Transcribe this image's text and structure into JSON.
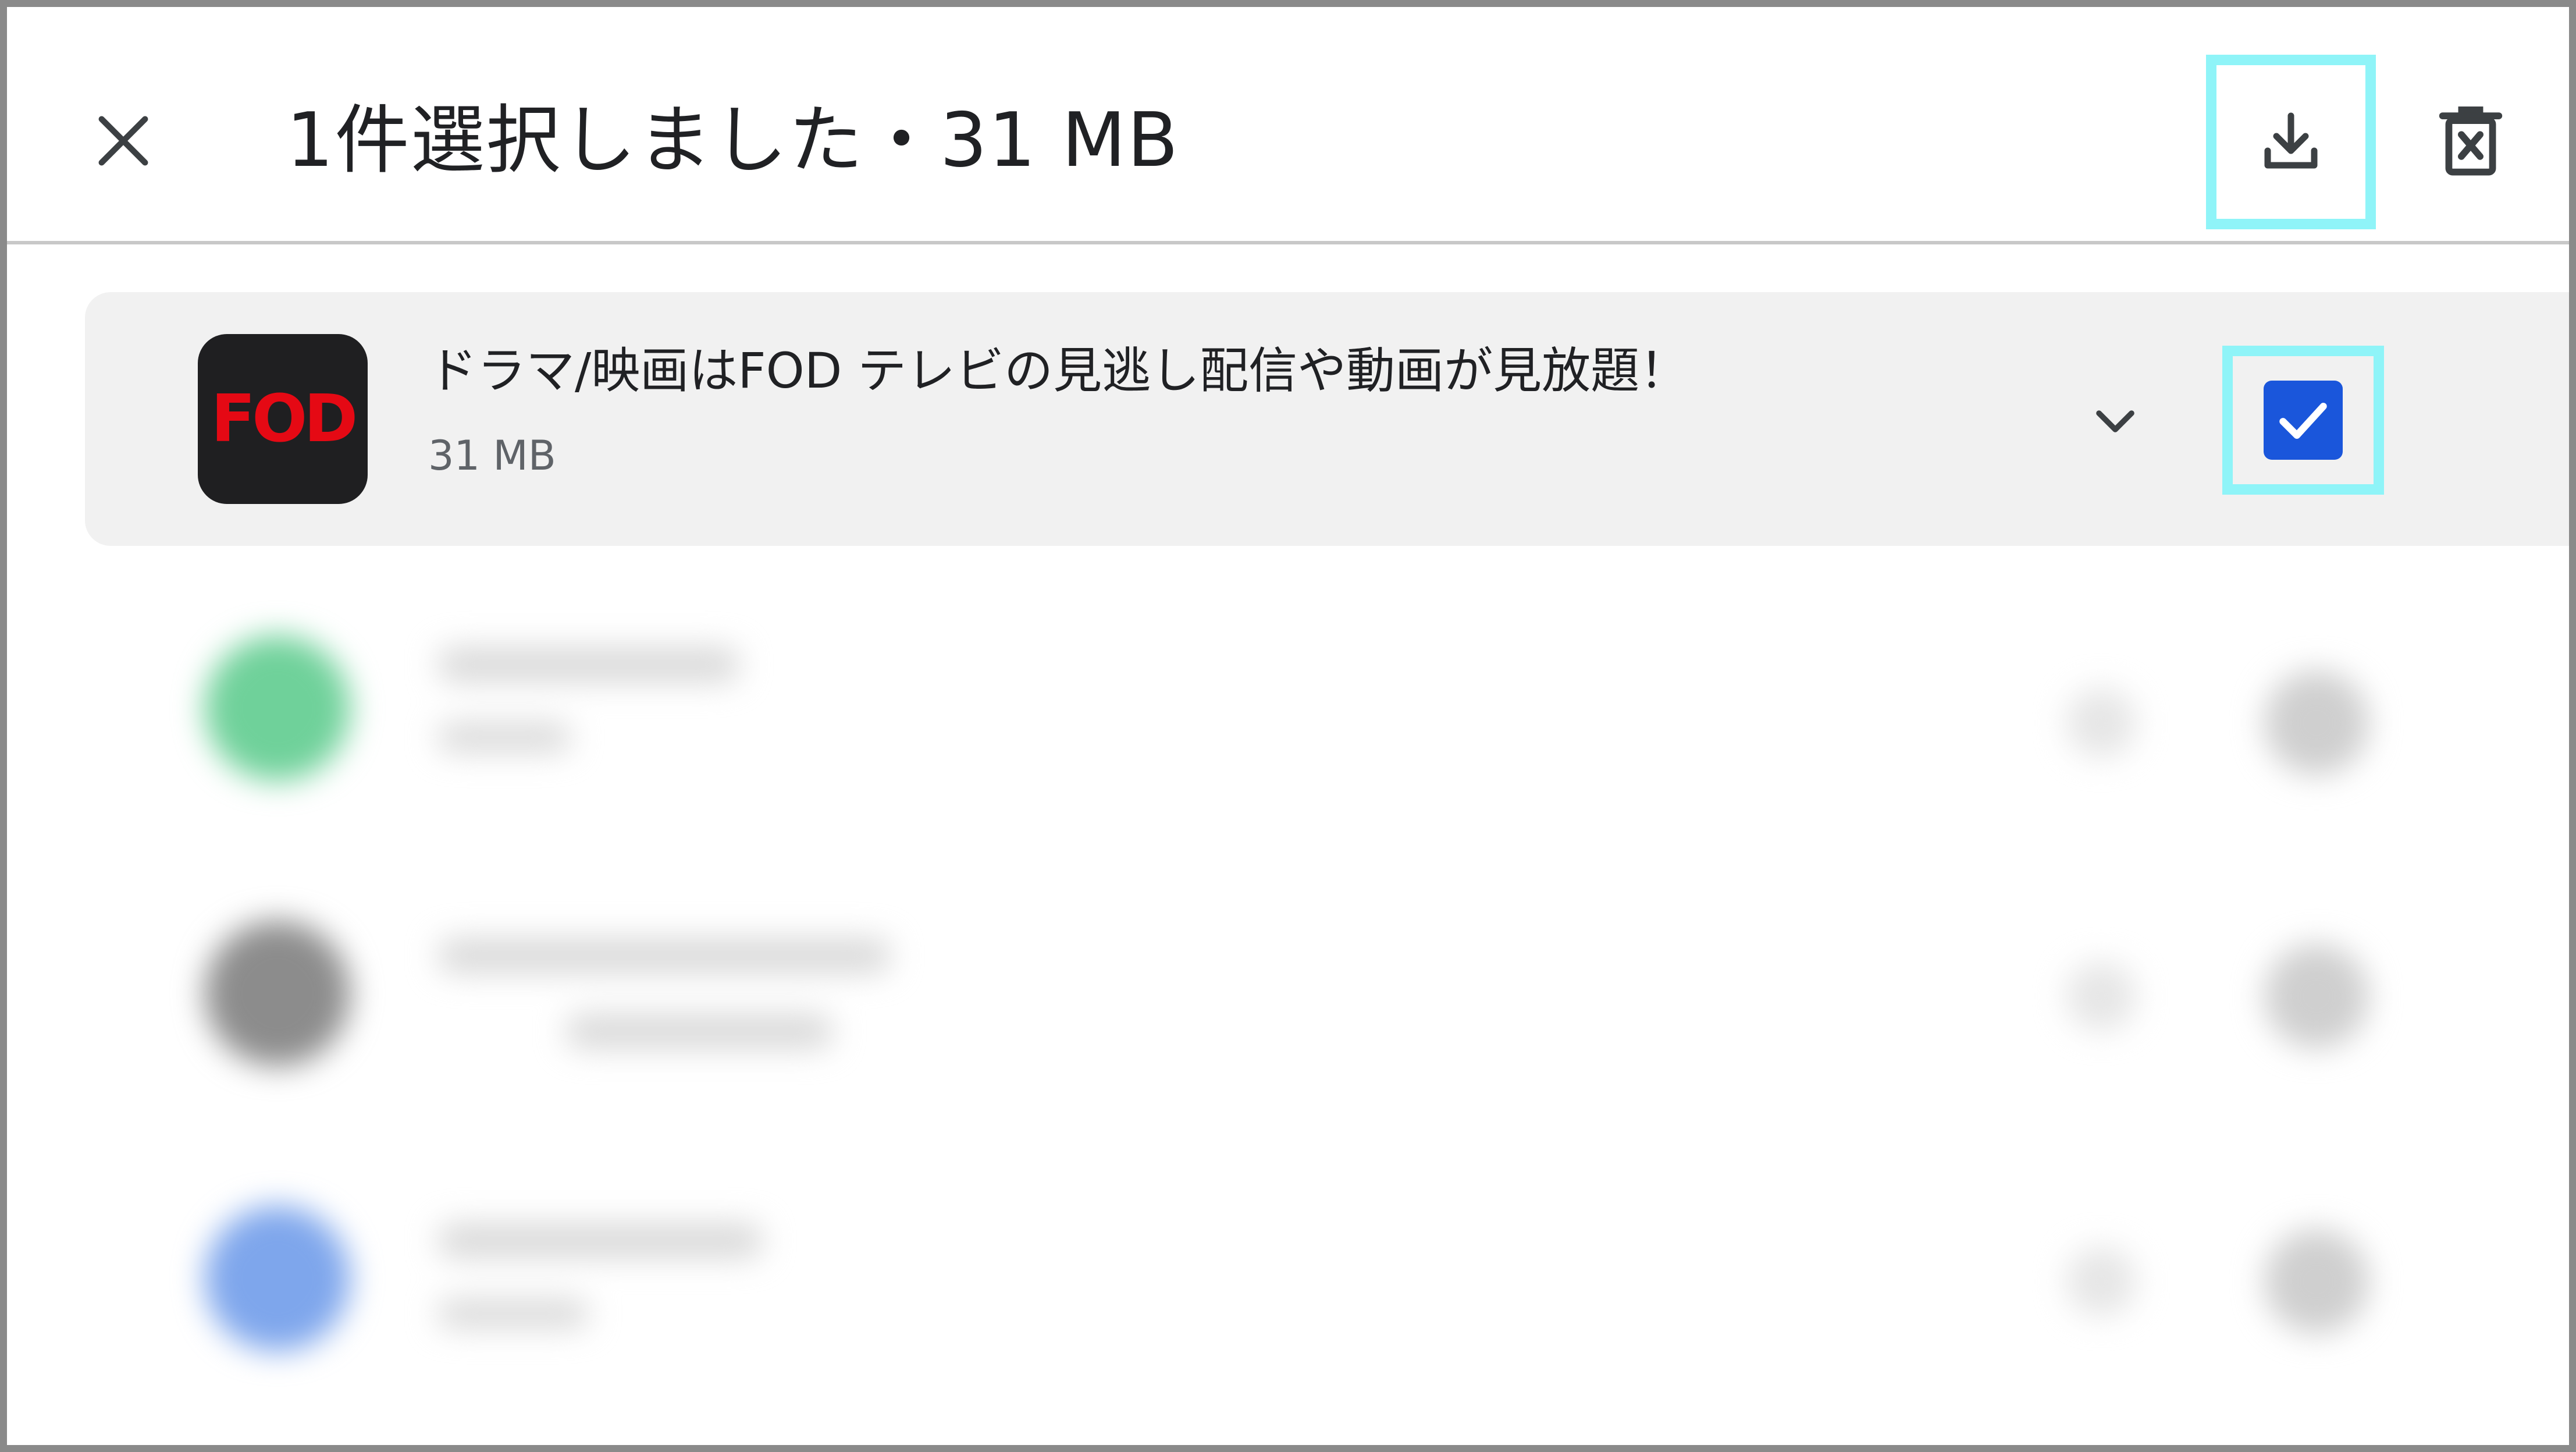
{
  "header": {
    "title": "1件選択しました・31 MB",
    "close_icon": "close-icon",
    "download_icon": "download-icon",
    "delete_icon": "delete-icon"
  },
  "selected_item": {
    "app_icon_text": "FOD",
    "title": "ドラマ/映画はFOD テレビの見逃し配信や動画が見放題！",
    "size": "31 MB",
    "checked": true,
    "expand_icon": "chevron-down-icon"
  },
  "colors": {
    "highlight": "#8ff4f8",
    "checkbox": "#1a56db",
    "fod_red": "#e50914",
    "blur_icons": [
      "#6fd19a",
      "#8c8c8c",
      "#7ea6ec"
    ]
  }
}
